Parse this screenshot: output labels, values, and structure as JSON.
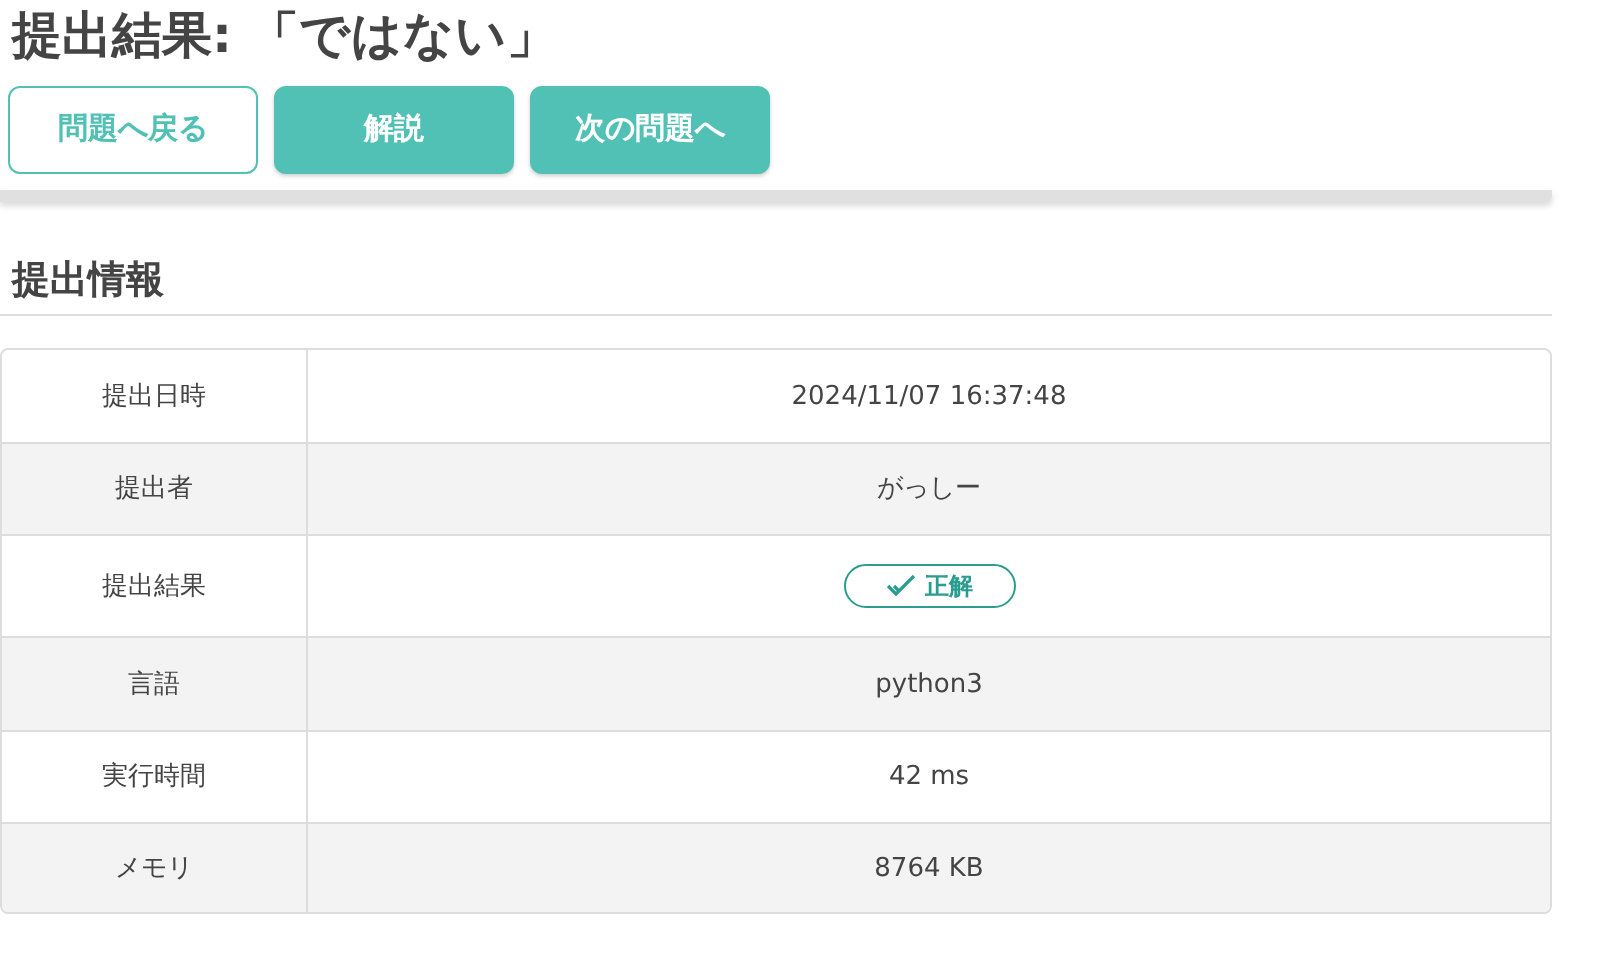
{
  "title": "提出結果: 「ではない」",
  "buttons": [
    {
      "label": "問題へ戻る",
      "kind": "outline"
    },
    {
      "label": "解説",
      "kind": "filled"
    },
    {
      "label": "次の問題へ",
      "kind": "filled"
    }
  ],
  "section": "提出情報",
  "rows": [
    {
      "label": "提出日時",
      "value": "2024/11/07 16:37:48",
      "kind": "text"
    },
    {
      "label": "提出者",
      "value": "がっしー",
      "kind": "text"
    },
    {
      "label": "提出結果",
      "value": "正解",
      "kind": "badge"
    },
    {
      "label": "言語",
      "value": "python3",
      "kind": "text"
    },
    {
      "label": "実行時間",
      "value": "42 ms",
      "kind": "text"
    },
    {
      "label": "メモリ",
      "value": "8764 KB",
      "kind": "text"
    }
  ]
}
